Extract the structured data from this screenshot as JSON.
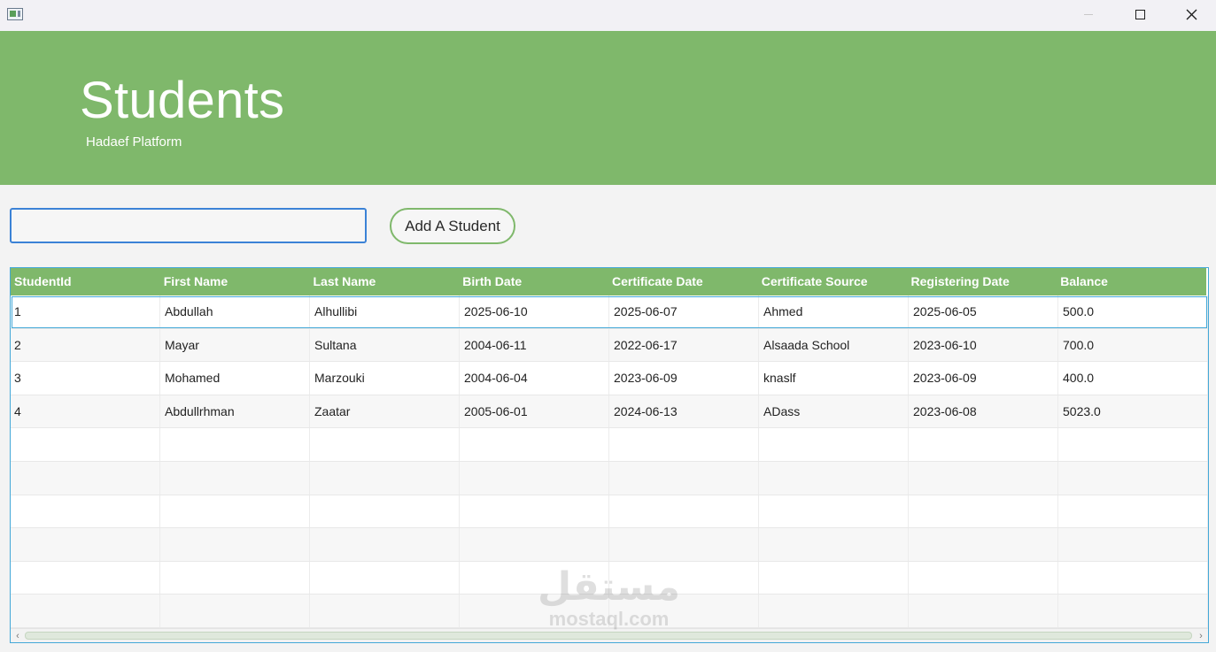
{
  "window": {
    "icons": {
      "app": "app-window-icon",
      "minimize": "minimize-icon",
      "maximize": "maximize-icon",
      "close": "close-icon"
    }
  },
  "header": {
    "title": "Students",
    "subtitle": "Hadaef Platform",
    "background_color": "#7fb86b"
  },
  "controls": {
    "search_value": "",
    "add_button_label": "Add A Student",
    "accent_color": "#3b82d6"
  },
  "table": {
    "columns": [
      "StudentId",
      "First Name",
      "Last Name",
      "Birth Date",
      "Certificate Date",
      "Certificate Source",
      "Registering Date",
      "Balance"
    ],
    "rows": [
      [
        "1",
        "Abdullah",
        "Alhullibi",
        "2025-06-10",
        "2025-06-07",
        "Ahmed",
        "2025-06-05",
        "500.0"
      ],
      [
        "2",
        "Mayar",
        "Sultana",
        "2004-06-11",
        "2022-06-17",
        "Alsaada School",
        "2023-06-10",
        "700.0"
      ],
      [
        "3",
        "Mohamed",
        "Marzouki",
        "2004-06-04",
        "2023-06-09",
        "knaslf",
        "2023-06-09",
        "400.0"
      ],
      [
        "4",
        "Abdullrhman",
        "Zaatar",
        "2005-06-01",
        "2024-06-13",
        "ADass",
        "2023-06-08",
        "5023.0"
      ]
    ],
    "selected_row": 0,
    "header_color": "#7fb86b"
  },
  "watermark": {
    "arabic": "مستقل",
    "latin": "mostaql.com"
  }
}
